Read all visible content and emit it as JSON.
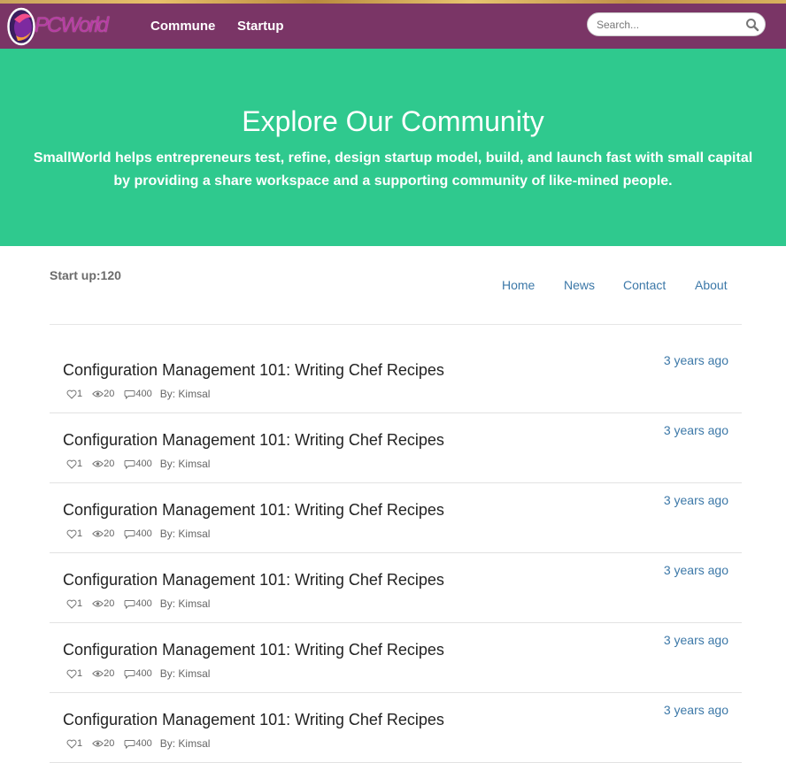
{
  "header": {
    "logo_text": "PCWorld",
    "nav": [
      {
        "label": "Commune"
      },
      {
        "label": "Startup"
      }
    ],
    "search": {
      "placeholder": "Search..."
    }
  },
  "hero": {
    "title": "Explore Our Community",
    "subtitle": "SmallWorld helps entrepreneurs test, refine, design startup model, build, and launch fast with small capital by providing a share workspace and a supporting community of like-mined people."
  },
  "section": {
    "count_label": "Start up:120",
    "nav": [
      {
        "label": "Home"
      },
      {
        "label": "News"
      },
      {
        "label": "Contact"
      },
      {
        "label": "About"
      }
    ]
  },
  "posts": [
    {
      "title": "Configuration Management 101: Writing Chef Recipes",
      "time": "3 years ago",
      "likes": "1",
      "views": "20",
      "comments": "400",
      "author": "By: Kimsal"
    },
    {
      "title": "Configuration Management 101: Writing Chef Recipes",
      "time": "3 years ago",
      "likes": "1",
      "views": "20",
      "comments": "400",
      "author": "By: Kimsal"
    },
    {
      "title": "Configuration Management 101: Writing Chef Recipes",
      "time": "3 years ago",
      "likes": "1",
      "views": "20",
      "comments": "400",
      "author": "By: Kimsal"
    },
    {
      "title": "Configuration Management 101: Writing Chef Recipes",
      "time": "3 years ago",
      "likes": "1",
      "views": "20",
      "comments": "400",
      "author": "By: Kimsal"
    },
    {
      "title": "Configuration Management 101: Writing Chef Recipes",
      "time": "3 years ago",
      "likes": "1",
      "views": "20",
      "comments": "400",
      "author": "By: Kimsal"
    },
    {
      "title": "Configuration Management 101: Writing Chef Recipes",
      "time": "3 years ago",
      "likes": "1",
      "views": "20",
      "comments": "400",
      "author": "By: Kimsal"
    }
  ],
  "colors": {
    "header_bg": "#7a3566",
    "hero_bg": "#2fc98e",
    "link": "#3c78a8"
  },
  "icons": {
    "like": "heart-icon",
    "views": "eye-icon",
    "comments": "comment-icon",
    "search": "search-icon"
  }
}
